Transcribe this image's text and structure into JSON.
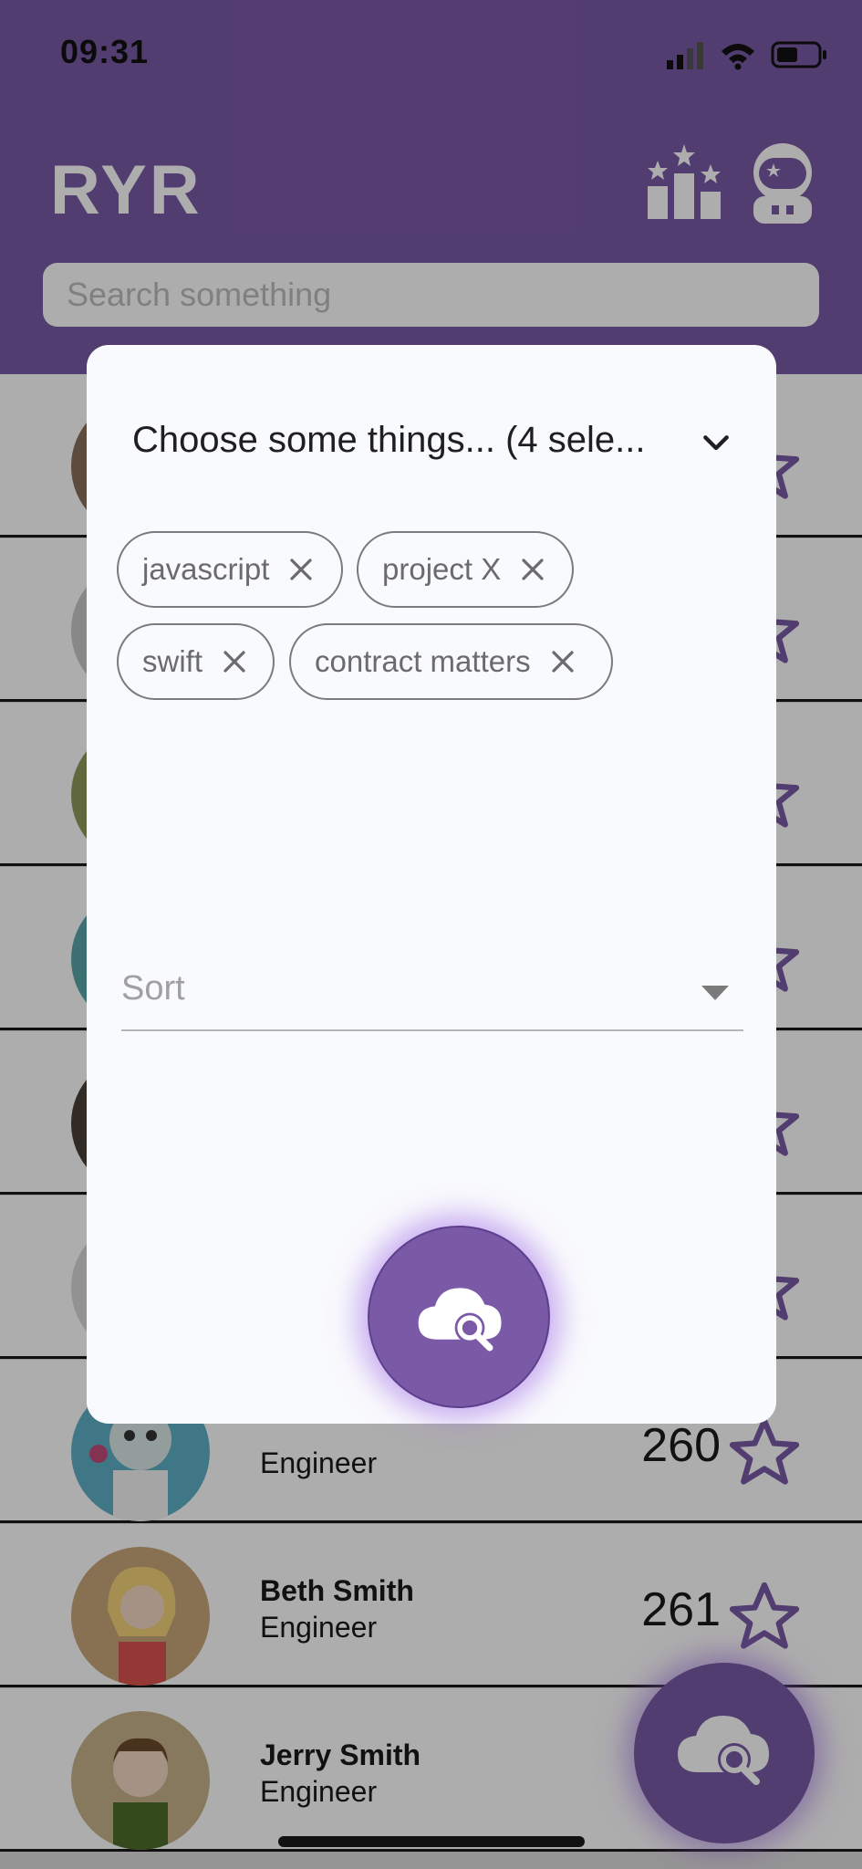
{
  "status_bar": {
    "time": "09:31"
  },
  "app": {
    "title": "RYR"
  },
  "search": {
    "placeholder": "Search something"
  },
  "rows": [
    {
      "name": "",
      "role": "",
      "score": ""
    },
    {
      "name": "",
      "role": "",
      "score": ""
    },
    {
      "name": "",
      "role": "",
      "score": ""
    },
    {
      "name": "",
      "role": "",
      "score": ""
    },
    {
      "name": "",
      "role": "",
      "score": ""
    },
    {
      "name": "",
      "role": "",
      "score": ""
    },
    {
      "name": "",
      "role": "Engineer",
      "score": "260"
    },
    {
      "name": "Beth Smith",
      "role": "Engineer",
      "score": "261"
    },
    {
      "name": "Jerry Smith",
      "role": "Engineer",
      "score": ""
    }
  ],
  "dialog": {
    "dropdown_label": "Choose some things... (4 sele...",
    "chips": [
      "javascript",
      "project X",
      "swift",
      "contract matters"
    ],
    "sort_label": "Sort"
  },
  "colors": {
    "accent": "#7a5aa6",
    "dialog_bg": "#f9fafd"
  },
  "icons": [
    "leaderboard-icon",
    "astronaut-icon",
    "star-icon",
    "cloud-search-icon",
    "chevron-down-icon",
    "close-icon",
    "caret-down-icon"
  ]
}
